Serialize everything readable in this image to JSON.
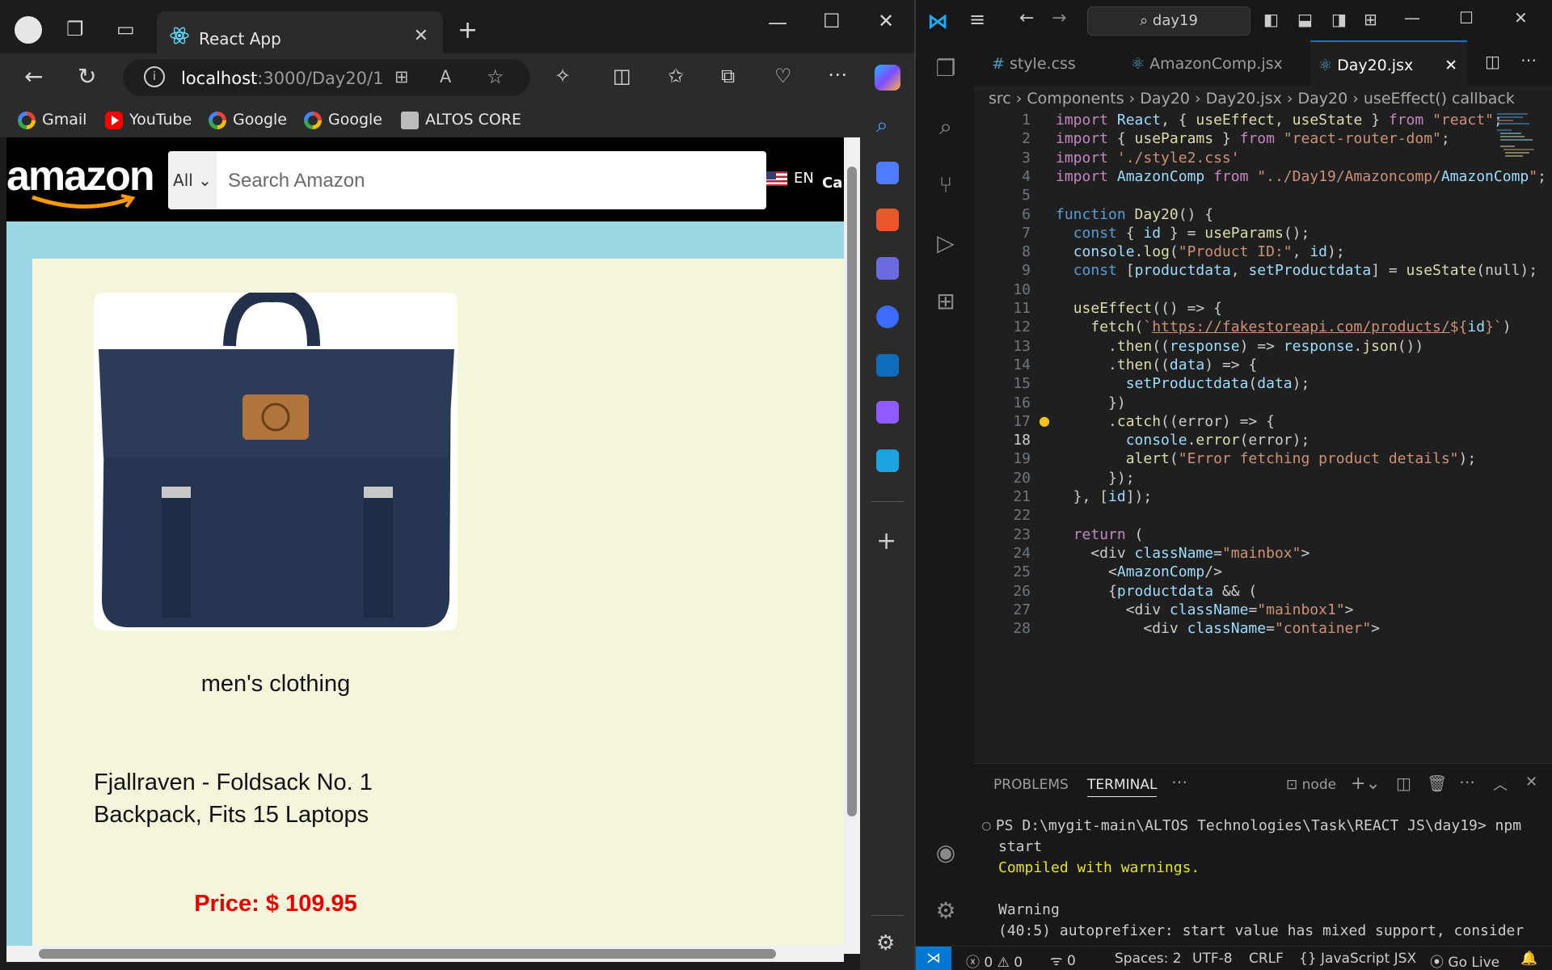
{
  "browser": {
    "tab_title": "React App",
    "address": {
      "host": "localhost",
      "path": ":3000/Day20/1"
    },
    "bookmarks": [
      "Gmail",
      "YouTube",
      "Google",
      "Google",
      "ALTOS CORE"
    ]
  },
  "amazon": {
    "logo": "amazon",
    "search_category": "All",
    "search_placeholder": "Search Amazon",
    "lang": "EN",
    "cart_partial": "Ca"
  },
  "product": {
    "category": "men's clothing",
    "title": "Fjallraven - Foldsack No. 1 Backpack, Fits 15 Laptops",
    "price": "Price: $ 109.95"
  },
  "vscode": {
    "command_center": "day19",
    "tabs": [
      "style.css",
      "AmazonComp.jsx",
      "Day20.jsx"
    ],
    "breadcrumb": "src › Components › Day20 › Day20.jsx › Day20 › useEffect() callback",
    "code_lines": [
      "import React, { useEffect, useState } from \"react\";",
      "import { useParams } from \"react-router-dom\";",
      "import './style2.css'",
      "import AmazonComp from \"../Day19/Amazoncomp/AmazonComp\";",
      "",
      "function Day20() {",
      "  const { id } = useParams();",
      "  console.log(\"Product ID:\", id);",
      "  const [productdata, setProductdata] = useState(null);",
      "",
      "  useEffect(() => {",
      "    fetch(`https://fakestoreapi.com/products/${id}`)",
      "      .then((response) => response.json())",
      "      .then((data) => {",
      "        setProductdata(data);",
      "      })",
      "      .catch((error) => {",
      "        console.error(error);",
      "        alert(\"Error fetching product details\");",
      "      });",
      "  }, [id]);",
      "",
      "  return (",
      "    <div className=\"mainbox\">",
      "      <AmazonComp/>",
      "      {productdata && (",
      "        <div className=\"mainbox1\">",
      "          <div className=\"container\">"
    ],
    "current_line": 18,
    "panel_tabs": [
      "PROBLEMS",
      "TERMINAL"
    ],
    "terminal_shell": "node",
    "terminal_lines": [
      "PS D:\\mygit-main\\ALTOS Technologies\\Task\\REACT JS\\day19> npm start",
      "Compiled with warnings.",
      "",
      "Warning",
      "(40:5) autoprefixer: start value has mixed support, consider"
    ],
    "status": {
      "errors": "0",
      "warnings": "0",
      "ports": "0",
      "spaces": "Spaces: 2",
      "encoding": "UTF-8",
      "eol": "CRLF",
      "language": "JavaScript JSX",
      "golive": "Go Live"
    }
  }
}
